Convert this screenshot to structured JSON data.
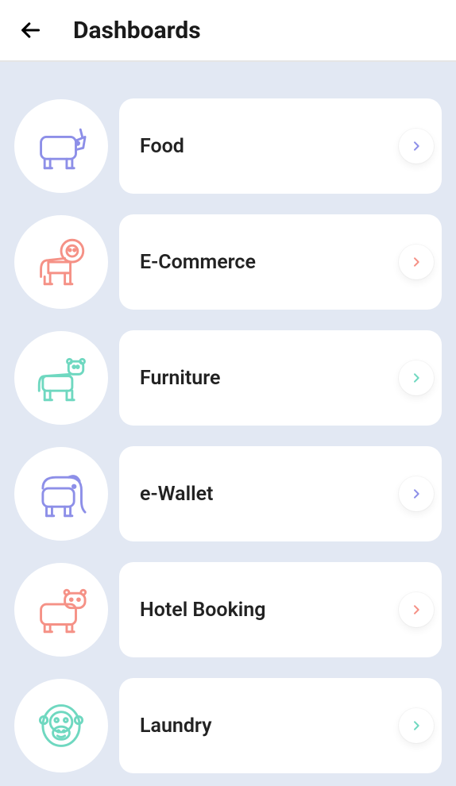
{
  "header": {
    "title": "Dashboards"
  },
  "items": [
    {
      "label": "Food",
      "icon": "rhino-icon",
      "color": "indigo"
    },
    {
      "label": "E-Commerce",
      "icon": "lion-icon",
      "color": "coral"
    },
    {
      "label": "Furniture",
      "icon": "cheetah-icon",
      "color": "mint"
    },
    {
      "label": "e-Wallet",
      "icon": "elephant-icon",
      "color": "indigo"
    },
    {
      "label": "Hotel Booking",
      "icon": "hippo-icon",
      "color": "coral"
    },
    {
      "label": "Laundry",
      "icon": "gorilla-icon",
      "color": "mint"
    }
  ]
}
